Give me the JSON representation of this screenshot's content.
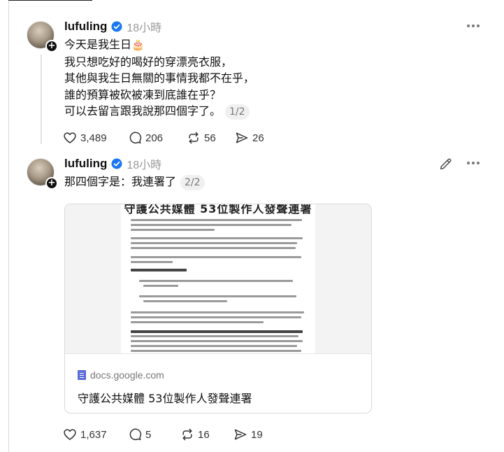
{
  "posts": [
    {
      "username": "lufuling",
      "time": "18小時",
      "lines": [
        "今天是我生日",
        "我只想吃好的喝好的穿漂亮衣服，",
        "其他與我生日無關的事情我都不在乎，",
        "誰的預算被砍被凍到底誰在乎？",
        "可以去留言跟我說那四個字了。"
      ],
      "emoji": "🎂",
      "page_badge": "1/2",
      "actions": {
        "likes": "3,489",
        "comments": "206",
        "reposts": "56",
        "shares": "26"
      }
    },
    {
      "username": "lufuling",
      "time": "18小時",
      "text": "那四個字是：我連署了",
      "page_badge": "2/2",
      "card": {
        "doc_title": "守護公共媒體 53位製作人發聲連署",
        "domain": "docs.google.com",
        "title": "守護公共媒體 53位製作人發聲連署"
      },
      "actions": {
        "likes": "1,637",
        "comments": "5",
        "reposts": "16",
        "shares": "19"
      }
    }
  ],
  "colors": {
    "verified": "#1877f2",
    "text": "#101010",
    "muted": "#999999",
    "docs_blue": "#5a6bd6"
  },
  "icons": [
    "heart-icon",
    "comment-icon",
    "repost-icon",
    "share-icon",
    "more-icon",
    "edit-icon",
    "verified-icon",
    "follow-plus-icon",
    "docs-icon"
  ]
}
